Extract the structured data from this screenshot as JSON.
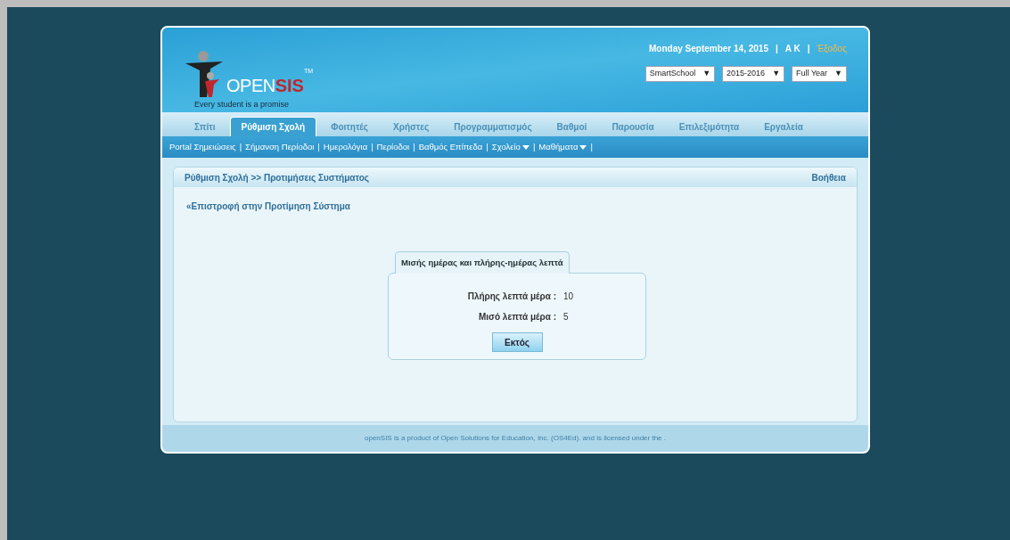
{
  "logo": {
    "open": "OPEN",
    "sis": "SIS",
    "tm": "TM",
    "tagline": "Every student is a promise"
  },
  "header": {
    "date": "Monday September 14, 2015",
    "separator1": "|",
    "user": "A K",
    "separator2": "|",
    "logout": "Έξοδος",
    "selects": [
      {
        "value": "SmartSchool",
        "arrow": "▼"
      },
      {
        "value": "2015-2016",
        "arrow": "▼"
      },
      {
        "value": "Full Year",
        "arrow": "▼"
      }
    ]
  },
  "tabs": [
    {
      "label": "Σπίτι",
      "selected": false
    },
    {
      "label": "Ρύθμιση Σχολή",
      "selected": true
    },
    {
      "label": "Φοιτητές",
      "selected": false
    },
    {
      "label": "Χρήστες",
      "selected": false
    },
    {
      "label": "Προγραμματισμός",
      "selected": false
    },
    {
      "label": "Βαθμοί",
      "selected": false
    },
    {
      "label": "Παρουσία",
      "selected": false
    },
    {
      "label": "Επιλεξιμότητα",
      "selected": false
    },
    {
      "label": "Εργαλεία",
      "selected": false
    }
  ],
  "subnav": [
    {
      "label": "Portal Σημειώσεις",
      "dropdown": false
    },
    {
      "label": "Σήμανση Περίοδοι",
      "dropdown": false
    },
    {
      "label": "Ημερολόγια",
      "dropdown": false
    },
    {
      "label": "Περίοδοι",
      "dropdown": false
    },
    {
      "label": "Βαθμός Επίπεδα",
      "dropdown": false
    },
    {
      "label": "Σχολείο",
      "dropdown": true
    },
    {
      "label": "Μαθήματα",
      "dropdown": true
    }
  ],
  "subnav_separator": "|",
  "panel": {
    "breadcrumb": "Ρύθμιση Σχολή >> Προτιμήσεις Συστήματος",
    "help": "Βοήθεια",
    "back_link": "«Επιστροφή στην Προτίμηση Σύστημα",
    "card": {
      "tab": "Μισής ημέρας και πλήρης-ημέρας λεπτά",
      "fields": [
        {
          "label": "Πλήρης λεπτά μέρα :",
          "value": "10"
        },
        {
          "label": "Μισό λεπτά μέρα :",
          "value": "5"
        }
      ],
      "button": "Εκτός"
    }
  },
  "footer": "openSIS is a product of Open Solutions for Education, Inc. (OS4Ed). and is licensed under the ."
}
